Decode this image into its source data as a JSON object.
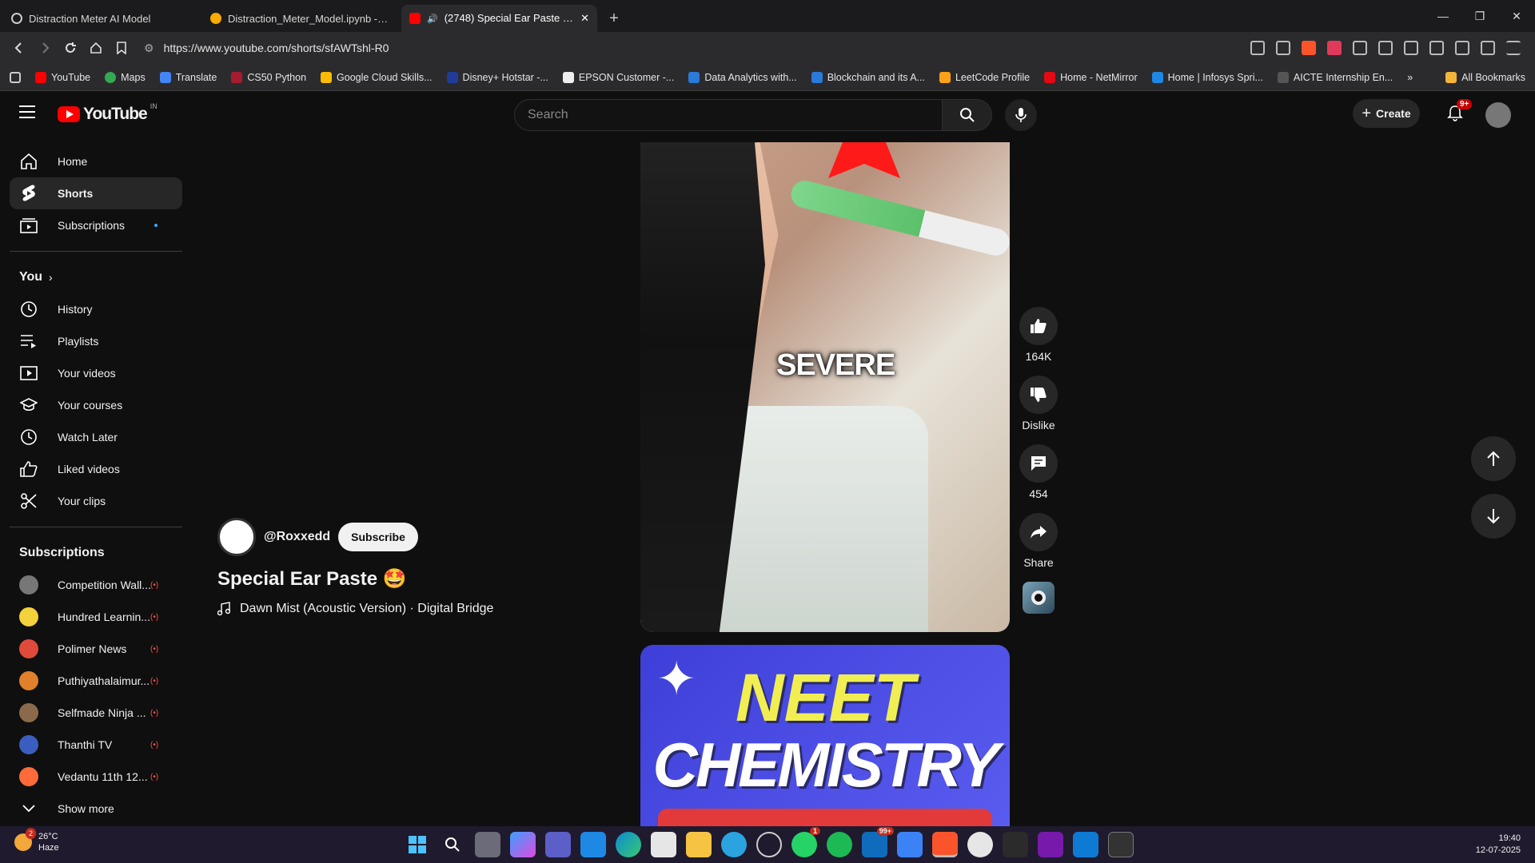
{
  "browser": {
    "tabs": [
      {
        "title": "Distraction Meter AI Model",
        "active": false
      },
      {
        "title": "Distraction_Meter_Model.ipynb - Col",
        "active": false
      },
      {
        "title": "(2748) Special Ear Paste 🤩 -",
        "active": true
      }
    ],
    "url": "https://www.youtube.com/shorts/sfAWTshl-R0",
    "bookmarks": [
      "YouTube",
      "Maps",
      "Translate",
      "CS50 Python",
      "Google Cloud Skills...",
      "Disney+ Hotstar -...",
      "EPSON Customer -...",
      "Data Analytics with...",
      "Blockchain and its A...",
      "LeetCode Profile",
      "Home - NetMirror",
      "Home | Infosys Spri...",
      "AICTE Internship En..."
    ],
    "all_bookmarks": "All Bookmarks"
  },
  "header": {
    "logo_text": "YouTube",
    "country": "IN",
    "search_placeholder": "Search",
    "create_label": "Create",
    "notif_count": "9+"
  },
  "sidebar": {
    "main": [
      {
        "label": "Home",
        "icon": "home-icon"
      },
      {
        "label": "Shorts",
        "icon": "shorts-icon",
        "active": true
      },
      {
        "label": "Subscriptions",
        "icon": "subscriptions-icon"
      }
    ],
    "you_header": "You",
    "you": [
      {
        "label": "History"
      },
      {
        "label": "Playlists"
      },
      {
        "label": "Your videos"
      },
      {
        "label": "Your courses"
      },
      {
        "label": "Watch Later"
      },
      {
        "label": "Liked videos"
      },
      {
        "label": "Your clips"
      }
    ],
    "subs_header": "Subscriptions",
    "subs": [
      {
        "name": "Competition Wall...",
        "color": "#777777"
      },
      {
        "name": "Hundred Learnin...",
        "color": "#f3d23b"
      },
      {
        "name": "Polimer News",
        "color": "#e04a3a"
      },
      {
        "name": "Puthiyathalaimur...",
        "color": "#e0802a"
      },
      {
        "name": "Selfmade Ninja ...",
        "color": "#8a6a4a"
      },
      {
        "name": "Thanthi TV",
        "color": "#3a5ec0"
      },
      {
        "name": "Vedantu 11th 12...",
        "color": "#ff6a3a"
      }
    ],
    "show_more": "Show more",
    "live_glyph": "(•)"
  },
  "video": {
    "overlay_text": "SEVERE",
    "next_title_1": "NEET",
    "next_title_2": "CHEMISTRY"
  },
  "actions": {
    "likes": "164K",
    "dislike": "Dislike",
    "comments": "454",
    "share": "Share"
  },
  "meta": {
    "channel": "@Roxxedd",
    "subscribe": "Subscribe",
    "title": "Special Ear Paste 🤩",
    "music": "Dawn Mist (Acoustic Version) · Digital Bridge"
  },
  "taskbar": {
    "temp": "26°C",
    "weather": "Haze",
    "weather_badge": "2",
    "time": "19:40",
    "date": "12-07-2025",
    "whatsapp_badge": "1",
    "mail_badge": "99+"
  }
}
